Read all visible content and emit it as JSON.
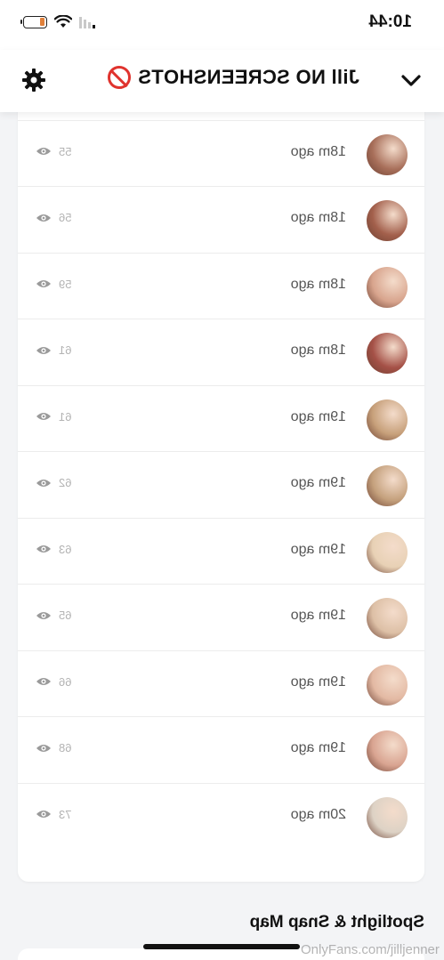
{
  "status_bar": {
    "time": "10:44"
  },
  "header": {
    "title": "Jill NO SCREENSHOTS"
  },
  "viewers": [
    {
      "time_ago": "18m ago",
      "views": "55",
      "color": "#b88b72"
    },
    {
      "time_ago": "18m ago",
      "views": "55",
      "color": "#a86f5a"
    },
    {
      "time_ago": "18m ago",
      "views": "56",
      "color": "#a3604c"
    },
    {
      "time_ago": "18m ago",
      "views": "59",
      "color": "#d8a48d"
    },
    {
      "time_ago": "18m ago",
      "views": "61",
      "color": "#a55147"
    },
    {
      "time_ago": "19m ago",
      "views": "61",
      "color": "#c7a07a"
    },
    {
      "time_ago": "19m ago",
      "views": "62",
      "color": "#c4a07c"
    },
    {
      "time_ago": "19m ago",
      "views": "63",
      "color": "#e8d1b5"
    },
    {
      "time_ago": "19m ago",
      "views": "65",
      "color": "#ddc0a6"
    },
    {
      "time_ago": "19m ago",
      "views": "66",
      "color": "#e3b9a3"
    },
    {
      "time_ago": "19m ago",
      "views": "68",
      "color": "#d9a491"
    },
    {
      "time_ago": "20m ago",
      "views": "73",
      "color": "#ddd2c5"
    }
  ],
  "section": {
    "title": "Spotlight & Snap Map"
  },
  "watermark": "OnlyFans.com/jilljenner"
}
